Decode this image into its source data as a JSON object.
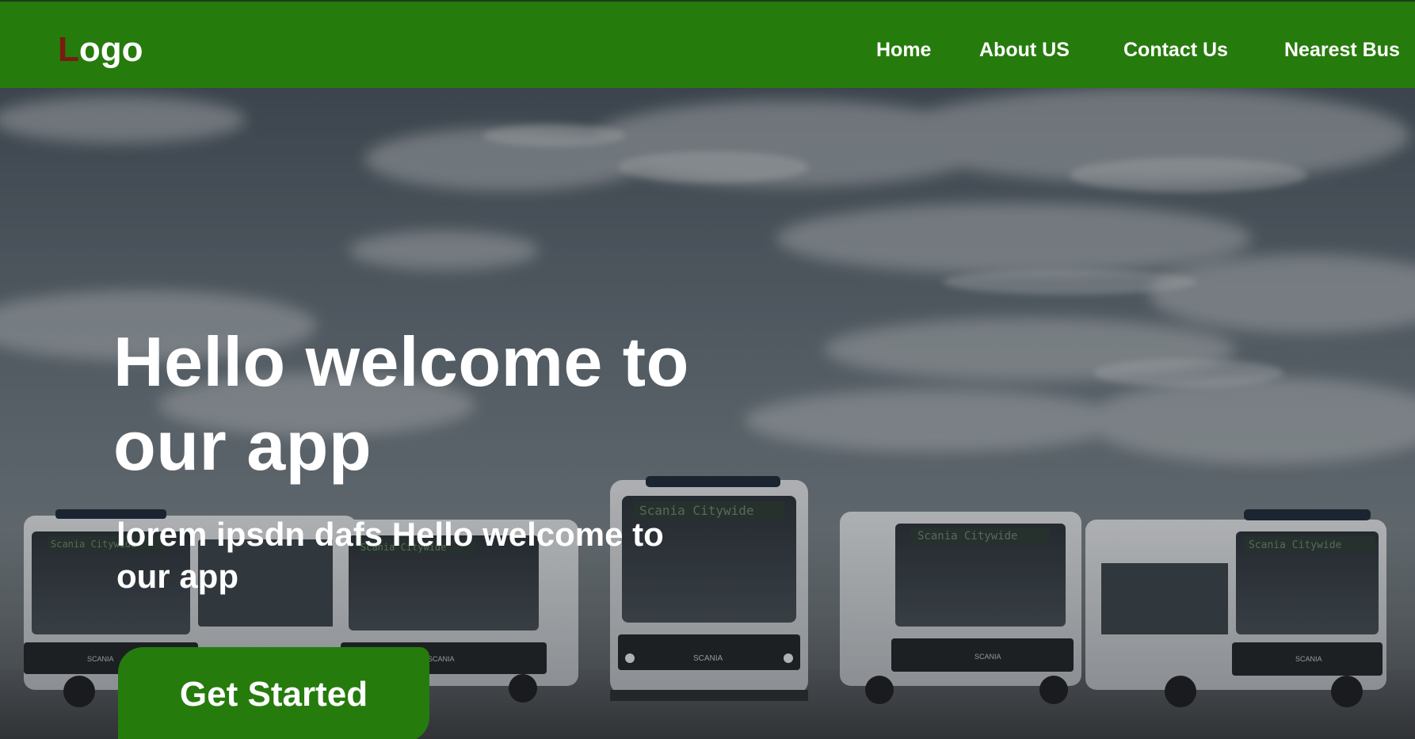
{
  "navbar": {
    "logo": {
      "first_letter": "L",
      "rest": "ogo"
    },
    "links": {
      "home": "Home",
      "about": "About US",
      "contact": "Contact Us",
      "nearest": "Nearest Bus"
    }
  },
  "hero": {
    "title": "Hello welcome to our app",
    "subtitle": "lorem ipsdn dafs Hello welcome to our app",
    "cta_label": "Get Started",
    "bus_signs": [
      "Scania Citywide",
      "Scania Citywide",
      "Scania Citywide",
      "Scania Citywide",
      "Scania Citywide"
    ],
    "bus_brand": "SCANIA"
  },
  "colors": {
    "nav_background": "#267b0d",
    "logo_accent": "#7a1a12",
    "button_background": "#267b0d",
    "text": "#ffffff"
  }
}
